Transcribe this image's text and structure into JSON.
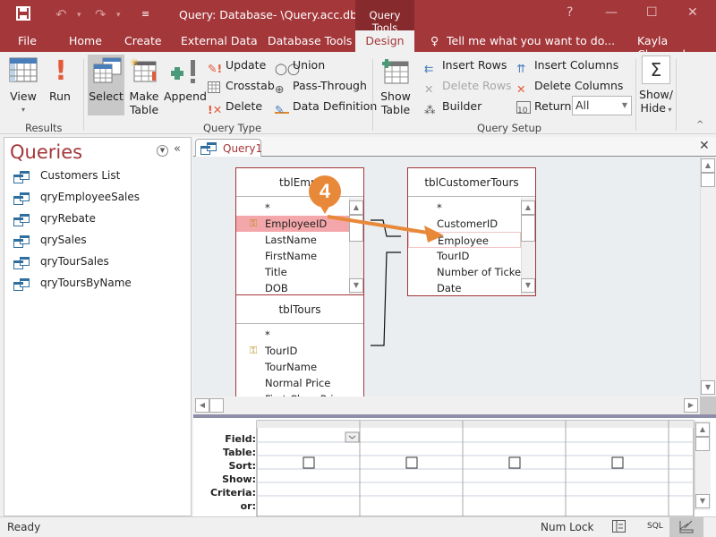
{
  "window": {
    "title": "Query: Database- \\Query.acc.db...",
    "context_tab_group": "Query Tools",
    "controls": [
      "?",
      "—",
      "☐",
      "✕"
    ]
  },
  "quick_access": {
    "save": "save-icon",
    "undo": "undo-icon",
    "redo": "redo-icon",
    "customize": "customize-icon"
  },
  "tabs": [
    {
      "label": "File"
    },
    {
      "label": "Home"
    },
    {
      "label": "Create"
    },
    {
      "label": "External Data"
    },
    {
      "label": "Database Tools"
    },
    {
      "label": "Design",
      "active": true
    }
  ],
  "tell_me": "Tell me what you want to do...",
  "user": "Kayla Claypool",
  "ribbon": {
    "results": {
      "label": "Results",
      "view": "View",
      "run": "Run"
    },
    "query_type": {
      "label": "Query Type",
      "select": "Select",
      "make_table_1": "Make",
      "make_table_2": "Table",
      "append": "Append",
      "update": "Update",
      "crosstab": "Crosstab",
      "delete": "Delete",
      "union": "Union",
      "pass_through": "Pass-Through",
      "data_definition": "Data Definition"
    },
    "query_setup": {
      "label": "Query Setup",
      "show_table_1": "Show",
      "show_table_2": "Table",
      "insert_rows": "Insert Rows",
      "delete_rows": "Delete Rows",
      "builder": "Builder",
      "insert_columns": "Insert Columns",
      "delete_columns": "Delete Columns",
      "return_label": "Return:",
      "return_value": "All"
    },
    "show_hide": {
      "line1": "Show/",
      "line2": "Hide"
    }
  },
  "nav": {
    "title": "Queries",
    "items": [
      {
        "label": "Customers List"
      },
      {
        "label": "qryEmployeeSales"
      },
      {
        "label": "qryRebate"
      },
      {
        "label": "qrySales"
      },
      {
        "label": "qryTourSales"
      },
      {
        "label": "qryToursByName"
      }
    ]
  },
  "doc_tab": "Query1",
  "tables": {
    "employees": {
      "title": "tblEmpl",
      "fields": [
        "*",
        "EmployeeID",
        "LastName",
        "FirstName",
        "Title",
        "DOB"
      ],
      "key": "EmployeeID"
    },
    "customer_tours": {
      "title": "tblCustomerTours",
      "fields": [
        "*",
        "CustomerID",
        "Employee",
        "TourID",
        "Number of Tickets",
        "Date"
      ]
    },
    "tours": {
      "title": "tblTours",
      "fields": [
        "*",
        "TourID",
        "TourName",
        "Normal Price",
        "First Class Price"
      ],
      "key": "TourID"
    }
  },
  "callout": "4",
  "grid": {
    "labels": [
      "Field:",
      "Table:",
      "Sort:",
      "Show:",
      "Criteria:",
      "or:"
    ]
  },
  "status": {
    "left": "Ready",
    "num_lock": "Num Lock",
    "sql": "SQL"
  },
  "colors": {
    "accent": "#a4373a",
    "callout": "#e8893a",
    "highlight": "#f4a7aa"
  }
}
